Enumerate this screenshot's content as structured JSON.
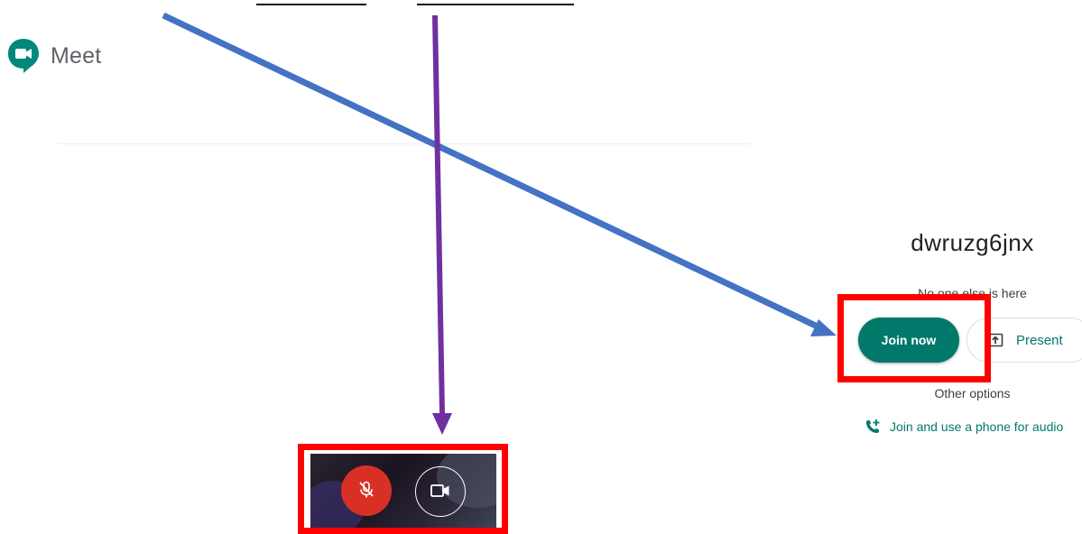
{
  "logo": {
    "text": "Meet",
    "icon": "meet-logo-icon"
  },
  "meeting": {
    "code": "dwruzg6jnx",
    "status": "No one else is here"
  },
  "actions": {
    "join_label": "Join now",
    "present_label": "Present",
    "present_icon": "present-upload-icon",
    "other_options_label": "Other options",
    "phone_label": "Join and use a phone for audio",
    "phone_icon": "phone-add-icon"
  },
  "preview": {
    "mic_icon": "mic-off-icon",
    "cam_icon": "camera-icon",
    "mic_muted": true
  },
  "annotations": {
    "box_color": "#ff0000",
    "arrow_blue": "#4472c4",
    "arrow_purple": "#7030a0"
  },
  "colors": {
    "accent": "#00796b",
    "mic_off": "#d93025",
    "text_primary": "#202124",
    "text_secondary": "#3c4043"
  }
}
